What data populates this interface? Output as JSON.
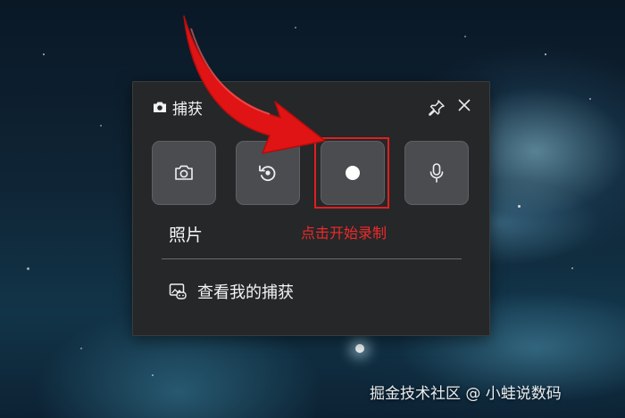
{
  "panel": {
    "title": "捕获",
    "title_icon": "camera-icon",
    "pin_icon": "pin-icon",
    "close_icon": "close-icon"
  },
  "capture_buttons": [
    {
      "name": "screenshot",
      "icon": "camera-icon"
    },
    {
      "name": "record-last-30s",
      "icon": "replay-icon"
    },
    {
      "name": "start-recording",
      "icon": "record-dot-icon"
    },
    {
      "name": "microphone",
      "icon": "microphone-icon"
    }
  ],
  "labels": {
    "photo": "照片",
    "record_hint": "点击开始录制"
  },
  "gallery": {
    "label": "查看我的捕获",
    "icon": "gallery-icon"
  },
  "watermark": "掘金技术社区 @ 小蛙说数码",
  "colors": {
    "panel_bg": "#252728",
    "button_bg": "#4a4c4f",
    "highlight": "#e01f1f",
    "hint_text": "#ee2a2a"
  }
}
